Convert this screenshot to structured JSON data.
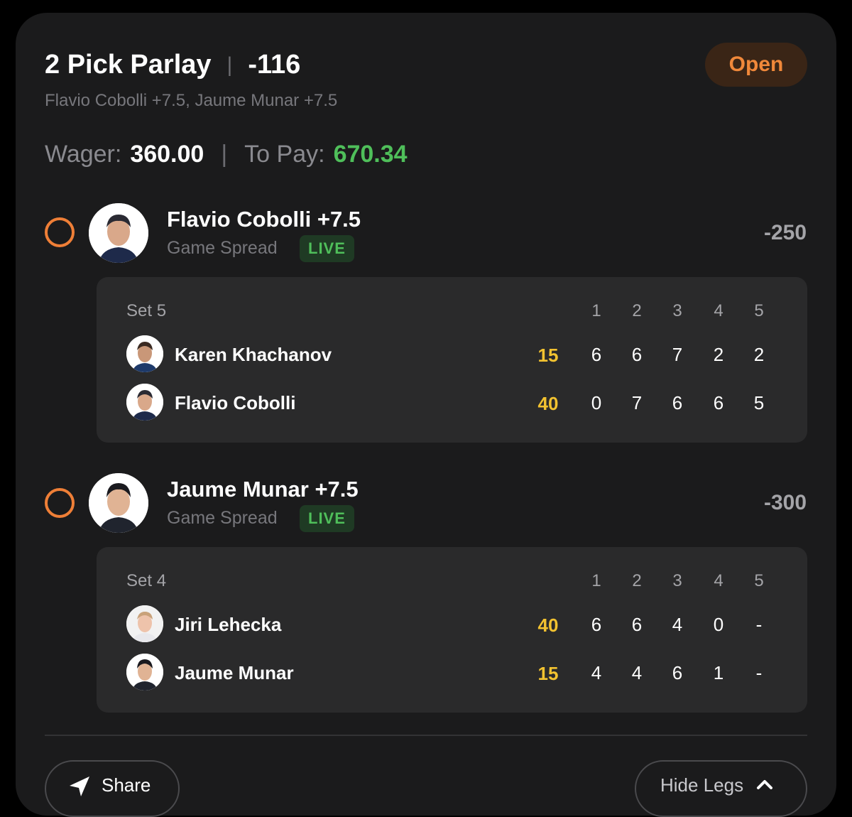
{
  "header": {
    "title": "2 Pick Parlay",
    "odds": "-116",
    "status": "Open",
    "picks_summary": "Flavio Cobolli +7.5, Jaume Munar +7.5"
  },
  "wager": {
    "wager_label": "Wager:",
    "wager_value": "360.00",
    "to_pay_label": "To Pay:",
    "to_pay_value": "670.34"
  },
  "legs": [
    {
      "title": "Flavio Cobolli +7.5",
      "market": "Game Spread",
      "badge": "LIVE",
      "odds": "-250",
      "scoreboard": {
        "set_label": "Set 5",
        "columns": [
          "1",
          "2",
          "3",
          "4",
          "5"
        ],
        "players": [
          {
            "name": "Karen Khachanov",
            "points": "15",
            "sets": [
              "6",
              "6",
              "7",
              "2",
              "2"
            ]
          },
          {
            "name": "Flavio Cobolli",
            "points": "40",
            "sets": [
              "0",
              "7",
              "6",
              "6",
              "5"
            ]
          }
        ]
      }
    },
    {
      "title": "Jaume Munar +7.5",
      "market": "Game Spread",
      "badge": "LIVE",
      "odds": "-300",
      "scoreboard": {
        "set_label": "Set 4",
        "columns": [
          "1",
          "2",
          "3",
          "4",
          "5"
        ],
        "players": [
          {
            "name": "Jiri Lehecka",
            "points": "40",
            "sets": [
              "6",
              "6",
              "4",
              "0",
              "-"
            ]
          },
          {
            "name": "Jaume Munar",
            "points": "15",
            "sets": [
              "4",
              "4",
              "6",
              "1",
              "-"
            ]
          }
        ]
      }
    }
  ],
  "footer": {
    "share_label": "Share",
    "share_icon": "paper-plane-icon",
    "hide_legs_label": "Hide Legs",
    "hide_legs_icon": "chevron-up-icon"
  },
  "colors": {
    "background": "#000000",
    "card": "#1b1b1c",
    "scorebox": "#2a2a2b",
    "accent_orange": "#ef7f37",
    "live_green": "#4fbf5a",
    "point_yellow": "#f2c230"
  }
}
